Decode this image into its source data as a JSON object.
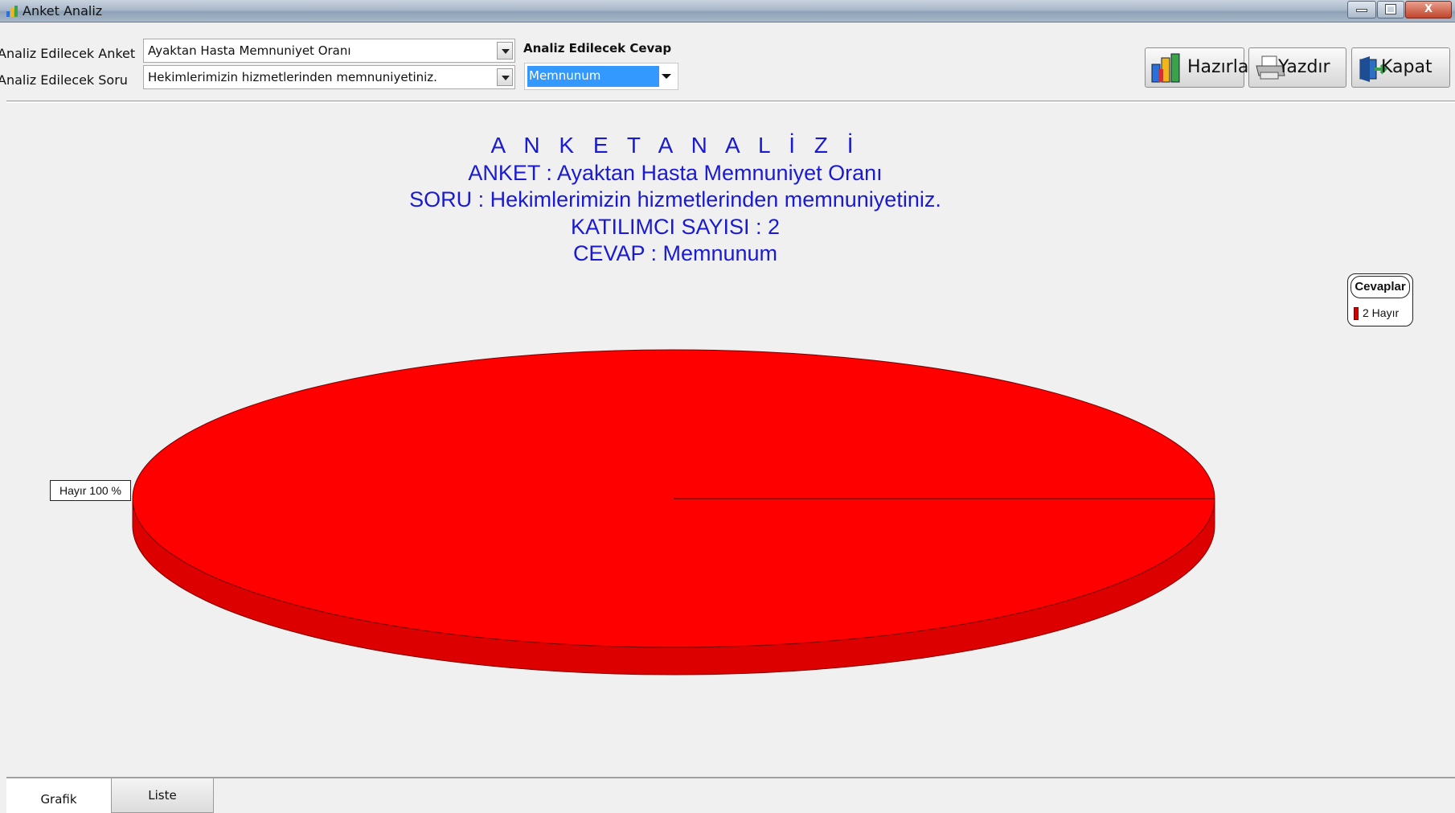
{
  "window": {
    "title": "Anket Analiz",
    "controls": {
      "minimize": "",
      "maximize": "",
      "close": "X"
    }
  },
  "filters": {
    "survey_label": "Analiz Edilecek Anket",
    "survey_value": "Ayaktan Hasta Memnuniyet Oranı",
    "question_label": "Analiz Edilecek Soru",
    "question_value": "Hekimlerimizin hizmetlerinden memnuniyetiniz.",
    "answer_label": "Analiz Edilecek Cevap",
    "answer_value": "Memnunum"
  },
  "toolbar": {
    "prepare_label": "Hazırla",
    "print_label": "Yazdır",
    "close_label": "Kapat"
  },
  "chart_data": {
    "type": "pie",
    "title": "A N K E T  A N A L İ Z İ",
    "subtitle_lines": [
      "ANKET : Ayaktan Hasta Memnuniyet Oranı",
      "SORU : Hekimlerimizin hizmetlerinden memnuniyetiniz.",
      "KATILIMCI SAYISI : 2",
      "CEVAP : Memnunum"
    ],
    "legend_title": "Cevaplar",
    "legend_placement": "top-right",
    "slices": [
      {
        "name": "Hayır",
        "value": 2,
        "percent": 100,
        "legend_text": "2 Hayır",
        "label": "Hayır 100 %",
        "color": "#ff0000"
      }
    ]
  },
  "tabs": [
    {
      "label": "Grafik",
      "active": true
    },
    {
      "label": "Liste",
      "active": false
    }
  ],
  "colors": {
    "title_text": "#1a1ad0",
    "pie_top": "#ff0000",
    "pie_side": "#dd0000"
  }
}
